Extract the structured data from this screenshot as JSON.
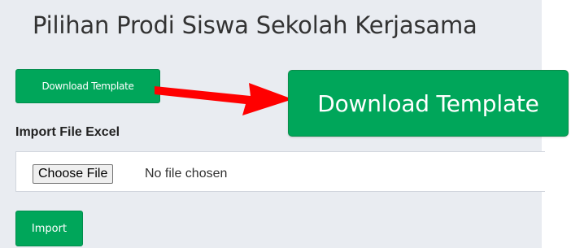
{
  "page": {
    "title": "Pilihan Prodi Siswa Sekolah Kerjasama"
  },
  "actions": {
    "download_template_label": "Download Template",
    "download_template_callout_label": "Download Template",
    "import_label": "Import"
  },
  "form": {
    "import_file_label": "Import File Excel",
    "choose_file_label": "Choose File",
    "no_file_text": "No file chosen"
  },
  "colors": {
    "button_green": "#00a65a",
    "panel_background": "#e9ecf1",
    "arrow_red": "#ff0000"
  },
  "icons": {
    "callout_arrow": "red-arrow-right"
  }
}
